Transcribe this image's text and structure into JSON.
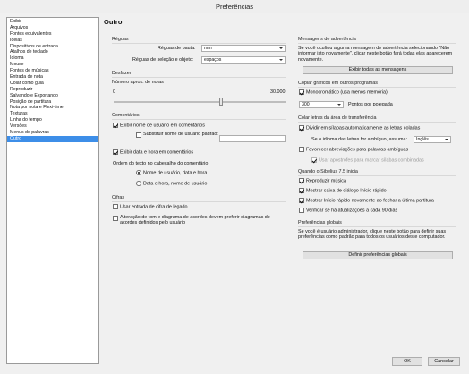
{
  "window": {
    "title": "Preferências"
  },
  "sidebar": {
    "items": [
      "Exibir",
      "Arquivos",
      "Fontes equivalentes",
      "Ideias",
      "Dispositivos de entrada",
      "Atalhos de teclado",
      "Idioma",
      "Mouse",
      "Fontes de músicas",
      "Entrada de nota",
      "Colar como guia",
      "Reproduzir",
      "Salvando e Exportando",
      "Posição de partitura",
      "Nota por nota e Flexi-time",
      "Texturas",
      "Linha do tempo",
      "Versões",
      "Menus de palavras",
      "Outro"
    ],
    "selected": "Outro"
  },
  "page": {
    "title": "Outro"
  },
  "rulers": {
    "group_label": "Réguas",
    "staff_ruler_label": "Réguas de pauta:",
    "staff_ruler_value": "mm",
    "selection_ruler_label": "Réguas de seleção e objeto:",
    "selection_ruler_value": "espaços"
  },
  "undo": {
    "group_label": "Desfazer",
    "steps_label": "Número aprox. de notas",
    "min": "0",
    "max": "30.000",
    "level": 0.63
  },
  "comments": {
    "group_label": "Comentários",
    "show_user_name": "Exibir nome de usuário em comentários",
    "show_user_name_checked": true,
    "replace_user_name": "Substituir nome de usuário padrão:",
    "replace_user_name_checked": false,
    "replace_user_name_value": "",
    "show_date_time": "Exibir data e hora em comentários",
    "show_date_time_checked": true,
    "header_order_label": "Ordem do texto no cabeçalho do comentário",
    "order_option_1": "Nome de usuário, data e hora",
    "order_option_2": "Data e hora, nome de usuário",
    "order_selected": 1
  },
  "chords": {
    "group_label": "Cifras",
    "legacy_input": "Usar entrada de cifra de legado",
    "legacy_input_checked": false,
    "prefer_user_text": "Alteração de tom e diagrama de acordes devem preferir diagramas de acordes definidos pelo usuário",
    "prefer_user_checked": false
  },
  "warnings": {
    "group_label": "Mensagens de advertência",
    "description": "Se você ocultou alguma mensagem de advertência selecionando \"Não informar isto novamente\", clicar neste botão fará todas elas aparecerem novamente.",
    "show_all_button": "Exibir todas as mensagens"
  },
  "graphics": {
    "group_label": "Copiar gráficos em outros programas",
    "monochrome": "Monocromático (usa menos memória)",
    "monochrome_checked": true,
    "dpi_value": "300",
    "dpi_label": "Pontos por polegada"
  },
  "lyrics": {
    "group_label": "Colar letras da área de transferência",
    "split_syllables": "Dividir em sílabas automaticamente as letras coladas",
    "split_checked": true,
    "ambiguous_label": "Se o idioma das letras for ambíguo, assuma:",
    "ambiguous_value": "Inglês",
    "favor_abbrev": "Favorecer abreviações para palavras ambíguas",
    "favor_checked": false,
    "apostrophes": "Usar apóstrofes para marcar sílabas combinadas",
    "apostrophes_checked": true
  },
  "startup": {
    "group_label": "Quando o Sibelius 7.5 inicia",
    "play_music": "Reproduzir música",
    "play_checked": true,
    "show_quickstart": "Mostrar caixa de diálogo Início rápido",
    "show_quickstart_checked": true,
    "show_after_close": "Mostrar Início rápido novamente ao fechar a última partitura",
    "show_after_close_checked": true,
    "check_updates": "Verificar se há atualizações a cada 90 dias",
    "check_updates_checked": false
  },
  "global": {
    "group_label": "Preferências globais",
    "description": "Se você é usuário administrador, clique neste botão para definir suas preferências como padrão para todos os usuários deste computador.",
    "set_button": "Definir preferências globais"
  },
  "footer": {
    "ok": "OK",
    "cancel": "Cancelar"
  }
}
